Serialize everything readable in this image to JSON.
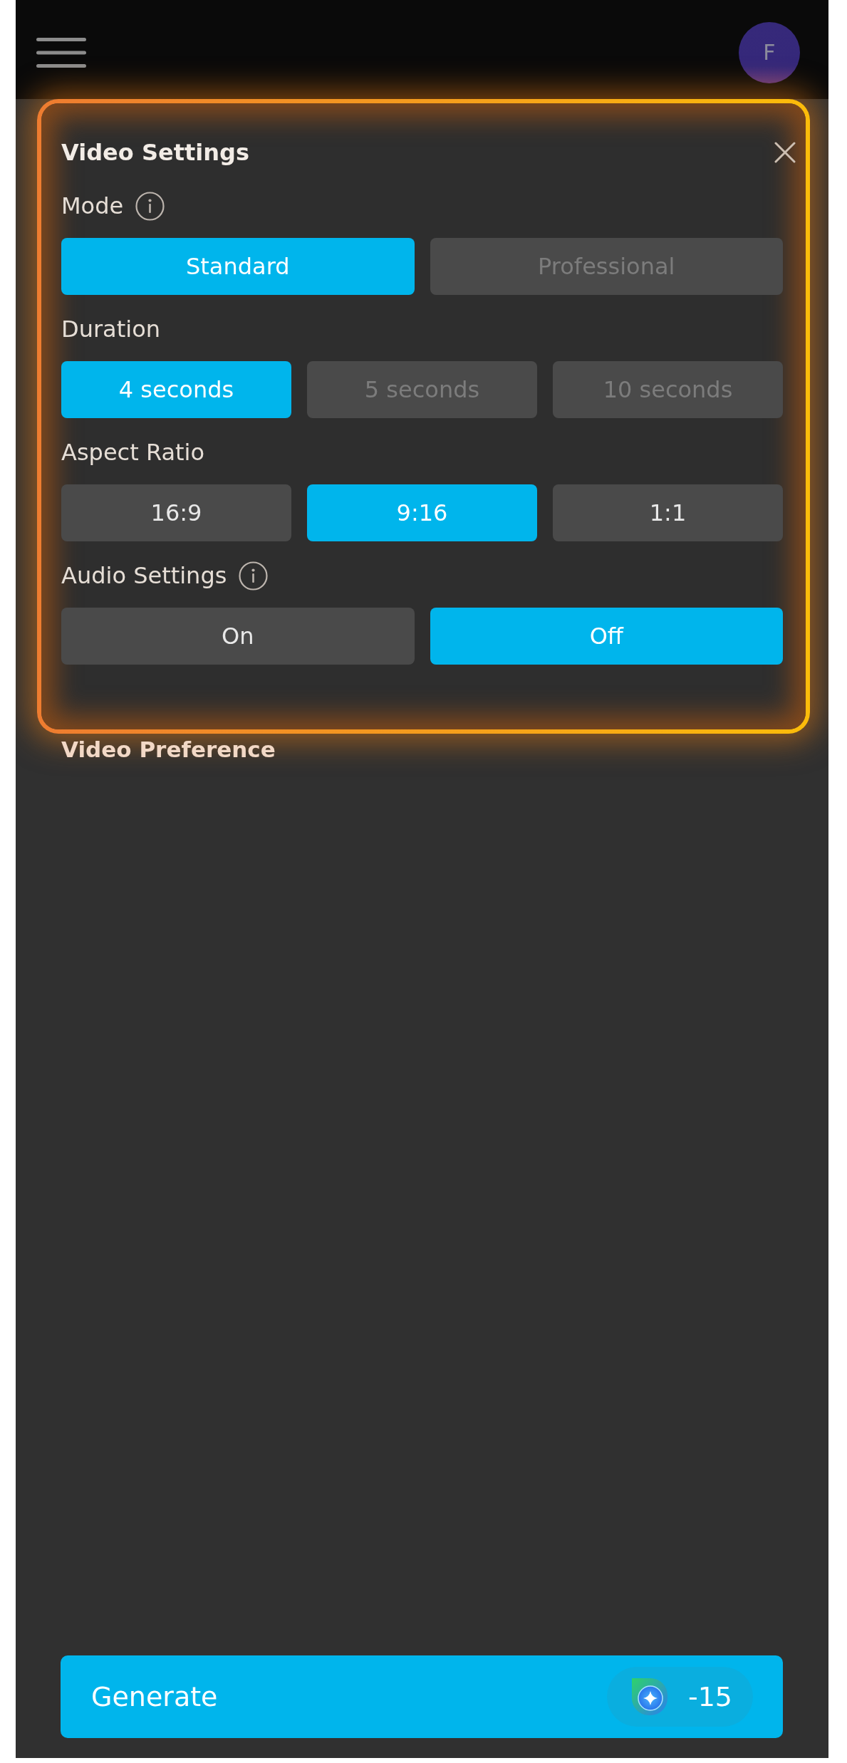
{
  "top_bar": {
    "avatar_initial": "F"
  },
  "video_settings": {
    "highlighted": true,
    "title": "Video Settings",
    "groups": [
      {
        "label": "Mode",
        "info": true,
        "options": [
          {
            "label": "Standard",
            "selected": true,
            "disabled": false
          },
          {
            "label": "Professional",
            "selected": false,
            "disabled": true
          }
        ]
      },
      {
        "label": "Duration",
        "info": false,
        "options": [
          {
            "label": "4 seconds",
            "selected": true,
            "disabled": false
          },
          {
            "label": "5 seconds",
            "selected": false,
            "disabled": true
          },
          {
            "label": "10 seconds",
            "selected": false,
            "disabled": true
          }
        ]
      },
      {
        "label": "Aspect Ratio",
        "info": false,
        "options": [
          {
            "label": "16:9",
            "selected": false,
            "disabled": false
          },
          {
            "label": "9:16",
            "selected": true,
            "disabled": false
          },
          {
            "label": "1:1",
            "selected": false,
            "disabled": false
          }
        ]
      },
      {
        "label": "Audio Settings",
        "info": true,
        "options": [
          {
            "label": "On",
            "selected": false,
            "disabled": false
          },
          {
            "label": "Off",
            "selected": true,
            "disabled": false
          }
        ]
      }
    ]
  },
  "video_preference": {
    "title": "Video Preference"
  },
  "generate_button": {
    "label": "Generate",
    "cost": "-15"
  }
}
